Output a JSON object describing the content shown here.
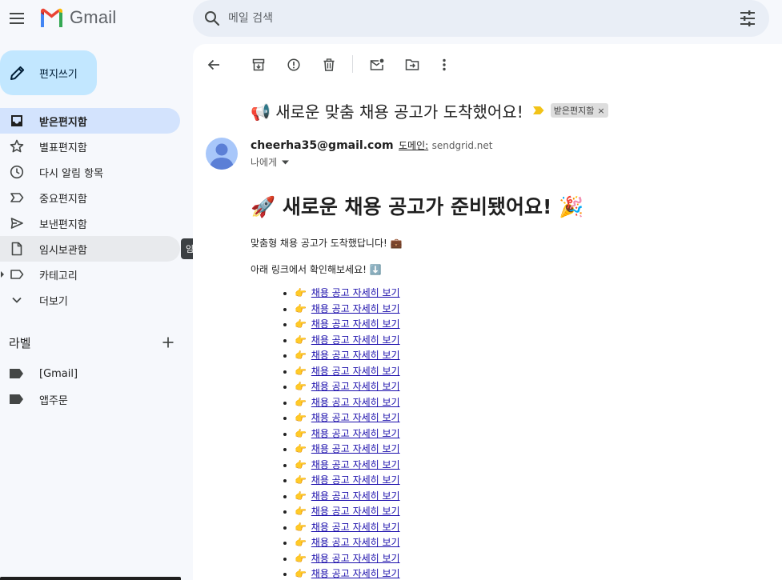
{
  "app": {
    "name": "Gmail"
  },
  "search": {
    "placeholder": "메일 검색"
  },
  "compose": {
    "label": "편지쓰기"
  },
  "nav": {
    "items": [
      {
        "label": "받은편지함",
        "icon": "inbox-icon",
        "active": true
      },
      {
        "label": "별표편지함",
        "icon": "star-icon"
      },
      {
        "label": "다시 알림 항목",
        "icon": "clock-icon"
      },
      {
        "label": "중요편지함",
        "icon": "label-important-icon"
      },
      {
        "label": "보낸편지함",
        "icon": "send-icon"
      },
      {
        "label": "임시보관함",
        "icon": "draft-icon",
        "hover": true
      },
      {
        "label": "카테고리",
        "icon": "label-outline-icon",
        "expandable": true
      },
      {
        "label": "더보기",
        "icon": "chevron-down-icon"
      }
    ],
    "tooltip": "임시보관함"
  },
  "labels": {
    "title": "라벨",
    "items": [
      {
        "label": "[Gmail]",
        "icon": "label-icon"
      },
      {
        "label": "앱주문",
        "icon": "label-icon"
      }
    ]
  },
  "message": {
    "subject": "📢 새로운 맞춤 채용 공고가 도착했어요!",
    "chip": "받은편지함",
    "chip_close": "×",
    "sender_email": "cheerha35@gmail.com",
    "via_label": "도메인:",
    "via_domain": "sendgrid.net",
    "to": "나에게",
    "heading": "🚀 새로운 채용 공고가 준비됐어요! 🎉",
    "p1": "맞춤형 채용 공고가 도착했답니다! 💼",
    "p2": "아래 링크에서 확인해보세요! ⬇️",
    "link_pointer": "👉",
    "links": [
      "채용 공고 자세히 보기",
      "채용 공고 자세히 보기",
      "채용 공고 자세히 보기",
      "채용 공고 자세히 보기",
      "채용 공고 자세히 보기",
      "채용 공고 자세히 보기",
      "채용 공고 자세히 보기",
      "채용 공고 자세히 보기",
      "채용 공고 자세히 보기",
      "채용 공고 자세히 보기",
      "채용 공고 자세히 보기",
      "채용 공고 자세히 보기",
      "채용 공고 자세히 보기",
      "채용 공고 자세히 보기",
      "채용 공고 자세히 보기",
      "채용 공고 자세히 보기",
      "채용 공고 자세히 보기",
      "채용 공고 자세히 보기",
      "채용 공고 자세히 보기"
    ]
  },
  "colors": {
    "page_bg": "#f6f8fc",
    "active_nav": "#d3e3fd",
    "compose_bg": "#c2e7ff",
    "search_bg": "#e9eef6",
    "link": "#1a0dab",
    "importance": "#f2c318"
  }
}
